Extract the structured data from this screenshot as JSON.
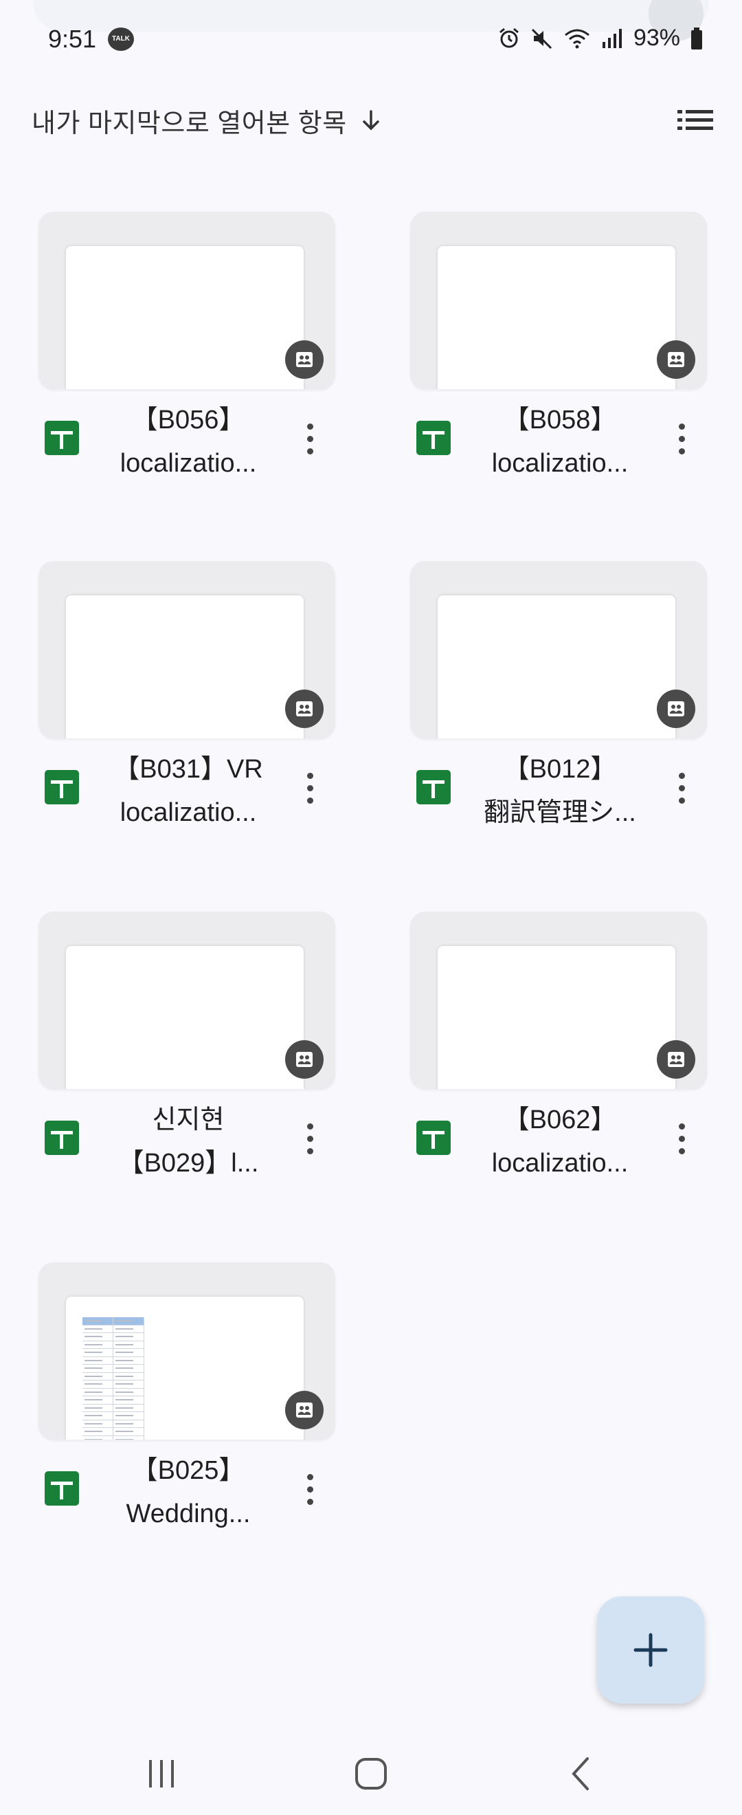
{
  "status_bar": {
    "time": "9:51",
    "talk_badge": "TALK",
    "battery": "93%"
  },
  "header": {
    "sort_label": "내가 마지막으로 열어본 항목",
    "sort_icon": "arrow-down-icon",
    "view_icon": "list-view-icon"
  },
  "files": [
    {
      "line1": "【B056】",
      "line2": "localizatio..."
    },
    {
      "line1": "【B058】",
      "line2": "localizatio..."
    },
    {
      "line1": "【B031】VR",
      "line2": "localizatio..."
    },
    {
      "line1": "【B012】",
      "line2": "翻訳管理シ..."
    },
    {
      "line1": "신지현",
      "line2": "【B029】l..."
    },
    {
      "line1": "【B062】",
      "line2": "localizatio..."
    },
    {
      "line1": "【B025】",
      "line2": "Wedding..."
    }
  ],
  "file_type_icon": "google-sheets-icon",
  "shared_badge_icon": "shared-drive-icon",
  "fab": {
    "icon": "plus-icon"
  },
  "nav": {
    "recents": "recents-icon",
    "home": "home-icon",
    "back": "back-icon"
  },
  "colors": {
    "accent": "#188038",
    "fab_bg": "#d3e3f3",
    "background": "#f9f9fd"
  }
}
